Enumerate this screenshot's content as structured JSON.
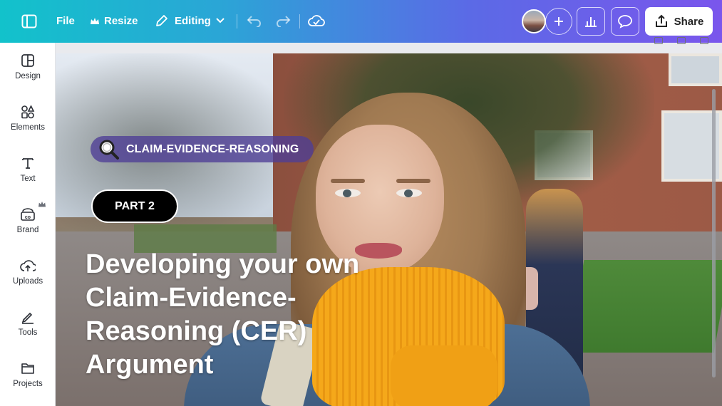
{
  "topbar": {
    "file_label": "File",
    "resize_label": "Resize",
    "editing_label": "Editing",
    "share_label": "Share"
  },
  "sidebar": {
    "items": [
      {
        "label": "Design",
        "icon": "design-icon"
      },
      {
        "label": "Elements",
        "icon": "elements-icon"
      },
      {
        "label": "Text",
        "icon": "text-icon"
      },
      {
        "label": "Brand",
        "icon": "brand-icon"
      },
      {
        "label": "Uploads",
        "icon": "uploads-icon"
      },
      {
        "label": "Tools",
        "icon": "tools-icon"
      },
      {
        "label": "Projects",
        "icon": "projects-icon"
      }
    ]
  },
  "slide": {
    "tag_label": "CLAIM-EVIDENCE-REASONING",
    "part_label": "PART 2",
    "headline": "Developing your own\nClaim-Evidence-\nReasoning (CER)\nArgument"
  },
  "colors": {
    "topbar_start": "#12c2cb",
    "topbar_end": "#7a56ec",
    "tag_bg": "#4e3e96",
    "pill_bg": "#000000"
  }
}
